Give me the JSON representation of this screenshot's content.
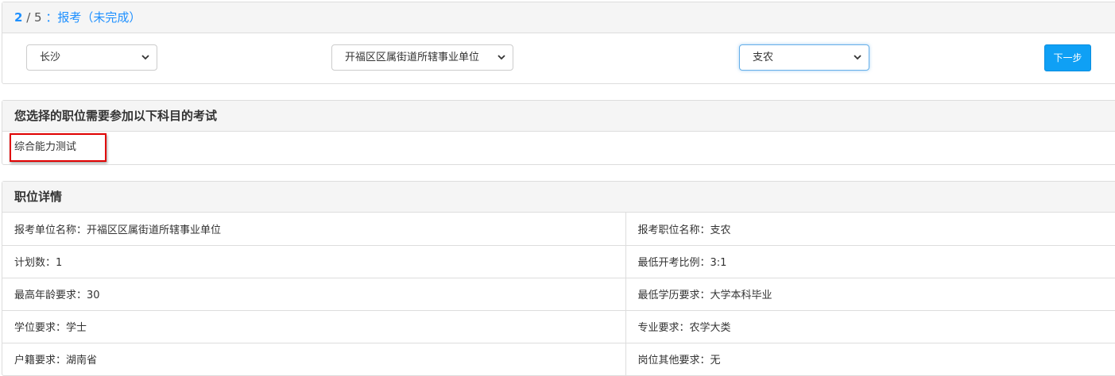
{
  "step": {
    "current": "2",
    "separator": " / ",
    "total": "5",
    "description": " ：报考（未完成）"
  },
  "filters": {
    "city": "长沙",
    "unit": "开福区区属街道所辖事业单位",
    "position": "支农"
  },
  "next_button": "下一步",
  "subjects": {
    "title": "您选择的职位需要参加以下科目的考试",
    "items": [
      "综合能力测试"
    ]
  },
  "details": {
    "title": "职位详情",
    "rows": [
      [
        "报考单位名称：开福区区属街道所辖事业单位",
        "报考职位名称：支农"
      ],
      [
        "计划数：1",
        "最低开考比例：3:1"
      ],
      [
        "最高年龄要求：30",
        "最低学历要求：大学本科毕业"
      ],
      [
        "学位要求：学士",
        "专业要求：农学大类"
      ],
      [
        "户籍要求：湖南省",
        "岗位其他要求：无"
      ]
    ]
  },
  "colors": {
    "accent": "#1e90ff",
    "button": "#0fa0f5",
    "highlight": "#e00000"
  },
  "icons": [
    "chevron-down-icon"
  ]
}
